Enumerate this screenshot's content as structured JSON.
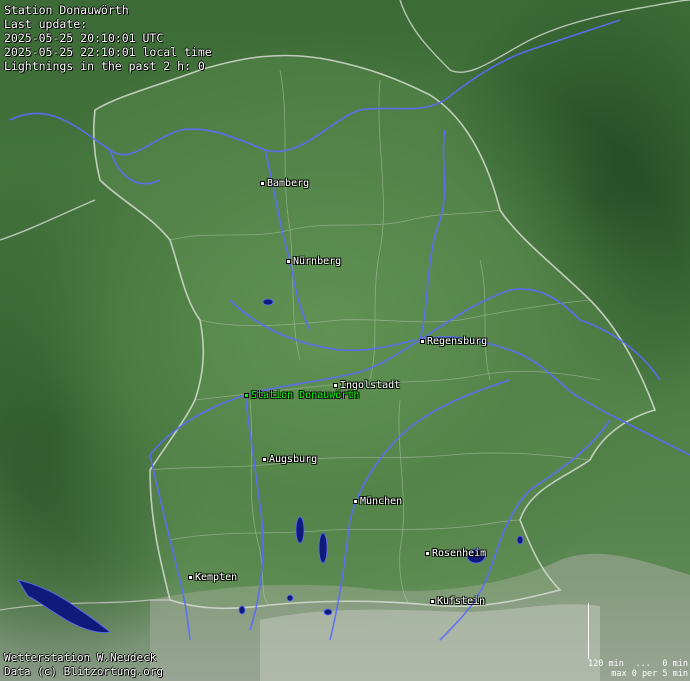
{
  "info": {
    "station_title": "Station Donauwörth",
    "last_update_label": "Last update:",
    "utc_time": "2025-05-25 20:10:01 UTC",
    "local_time": "2025-05-25 22:10:01 local time",
    "lightning_count": "Lightnings in the past 2 h: 0"
  },
  "cities": [
    {
      "name": "Bamberg"
    },
    {
      "name": "Nürnberg"
    },
    {
      "name": "Regensburg"
    },
    {
      "name": "Ingolstadt"
    },
    {
      "name": "Augsburg"
    },
    {
      "name": "München"
    },
    {
      "name": "Rosenheim"
    },
    {
      "name": "Kempten"
    },
    {
      "name": "Kufstein"
    }
  ],
  "station": {
    "name": "Station Donauwörth"
  },
  "credits": {
    "line1": "Wetterstation W.Neudeck",
    "line2": "Data (c) Blitzortung.org"
  },
  "legend": {
    "left": "120 min",
    "dots": "...",
    "right": "0 min",
    "sub": "max 0 per 5 min"
  },
  "colors": {
    "river": "#5b6cff",
    "border": "#cfd8cf",
    "lake": "#101a7a",
    "station": "#00ff00"
  }
}
